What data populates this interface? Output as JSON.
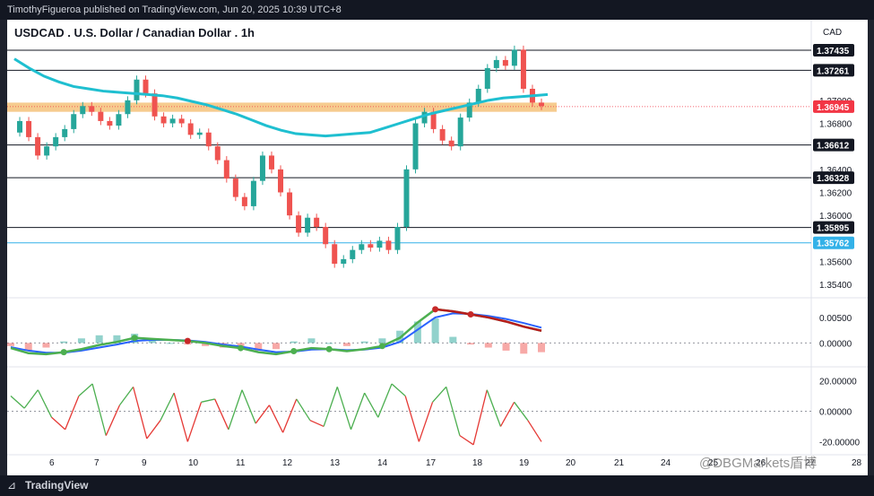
{
  "header": {
    "published": "TimothyFigueroa published on TradingView.com, Jun 20, 2025 10:39 UTC+8",
    "symbol_title": "USDCAD . U.S. Dollar / Canadian Dollar . 1h",
    "currency": "CAD"
  },
  "footer": {
    "brand": "TradingView",
    "watermark": "@DBGMarkets盾博"
  },
  "colors": {
    "up": "#26a69a",
    "down": "#ef5350",
    "ma": "#1fbfd0",
    "zone": "#f5c27a",
    "price_badge": "#f23645",
    "blue_line": "#33b1e8"
  },
  "chart_data": {
    "type": "line",
    "title": "USDCAD . U.S. Dollar / Canadian Dollar . 1h",
    "x_tick_labels": [
      "6",
      "7",
      "9",
      "10",
      "11",
      "12",
      "13",
      "14",
      "17",
      "18",
      "19",
      "20",
      "21",
      "24",
      "25",
      "26",
      "27",
      "28"
    ],
    "price_axis_ticks": [
      "1.37000",
      "1.36800",
      "1.36400",
      "1.36200",
      "1.36000",
      "1.35600",
      "1.35400"
    ],
    "ylim": [
      1.353,
      1.377
    ],
    "horizontal_levels": [
      {
        "label": "1.37435",
        "value": 1.37435
      },
      {
        "label": "1.37261",
        "value": 1.37261
      },
      {
        "label": "1.36612",
        "value": 1.36612
      },
      {
        "label": "1.36328",
        "value": 1.36328
      },
      {
        "label": "1.35895",
        "value": 1.35895
      }
    ],
    "blue_level": {
      "label": "1.35762",
      "value": 1.35762
    },
    "current_price": {
      "label": "1.36945",
      "value": 1.36945
    },
    "resistance_zone": [
      1.369,
      1.3698
    ],
    "price_series": [
      1.3672,
      1.3682,
      1.3668,
      1.3652,
      1.366,
      1.3668,
      1.3675,
      1.3688,
      1.3695,
      1.369,
      1.3682,
      1.3678,
      1.3688,
      1.37,
      1.3718,
      1.3706,
      1.3686,
      1.368,
      1.3684,
      1.368,
      1.367,
      1.3672,
      1.366,
      1.3648,
      1.3632,
      1.3616,
      1.3608,
      1.363,
      1.3652,
      1.364,
      1.362,
      1.36,
      1.3585,
      1.3598,
      1.359,
      1.3575,
      1.3558,
      1.3562,
      1.357,
      1.3575,
      1.3572,
      1.3578,
      1.357,
      1.359,
      1.364,
      1.368,
      1.369,
      1.3675,
      1.3665,
      1.366,
      1.3685,
      1.3698,
      1.371,
      1.3728,
      1.3735,
      1.373,
      1.3744,
      1.371,
      1.3698,
      1.3695
    ],
    "ma_series": [
      1.3736,
      1.3728,
      1.3721,
      1.3716,
      1.3712,
      1.371,
      1.3708,
      1.3707,
      1.3706,
      1.3705,
      1.3704,
      1.3702,
      1.3699,
      1.3696,
      1.3692,
      1.3688,
      1.3683,
      1.3678,
      1.3674,
      1.3671,
      1.367,
      1.3669,
      1.367,
      1.3671,
      1.3672,
      1.3676,
      1.368,
      1.3684,
      1.3688,
      1.3691,
      1.3694,
      1.3697,
      1.37,
      1.3702,
      1.3703,
      1.3704,
      1.3705
    ],
    "ma_span": [
      8,
      603
    ],
    "macd": {
      "ticks": [
        "0.00500",
        "0.00000"
      ],
      "ylim": [
        -0.0045,
        0.0085
      ],
      "line": [
        -0.001,
        -0.002,
        -0.0022,
        -0.0018,
        -0.0012,
        -0.0004,
        0.0002,
        0.001,
        0.0008,
        0.0006,
        0.0004,
        0.0,
        -0.0006,
        -0.001,
        -0.0018,
        -0.0022,
        -0.0016,
        -0.001,
        -0.0012,
        -0.0016,
        -0.0012,
        -0.0006,
        0.001,
        0.004,
        0.0066,
        0.0062,
        0.0056,
        0.005,
        0.0042,
        0.0032,
        0.0024
      ],
      "signal": [
        -0.0008,
        -0.0015,
        -0.0019,
        -0.0019,
        -0.0015,
        -0.0009,
        -0.0003,
        0.0004,
        0.0006,
        0.0006,
        0.0005,
        0.0002,
        -0.0003,
        -0.0007,
        -0.0013,
        -0.0018,
        -0.0017,
        -0.0013,
        -0.0012,
        -0.0014,
        -0.0013,
        -0.0009,
        0.0002,
        0.0026,
        0.005,
        0.0058,
        0.0057,
        0.0053,
        0.0047,
        0.0039,
        0.003
      ]
    },
    "oscillator": {
      "ticks": [
        "20.00000",
        "0.00000",
        "-20.00000"
      ],
      "ylim": [
        -28,
        28
      ],
      "values": [
        10,
        2,
        14,
        -4,
        -12,
        10,
        18,
        -16,
        4,
        16,
        -18,
        -6,
        12,
        -20,
        6,
        8,
        -12,
        14,
        -8,
        4,
        -14,
        8,
        -6,
        -10,
        16,
        -12,
        12,
        -4,
        18,
        10,
        -20,
        6,
        16,
        -16,
        -22,
        14,
        -10,
        6,
        -6,
        -20
      ]
    }
  }
}
